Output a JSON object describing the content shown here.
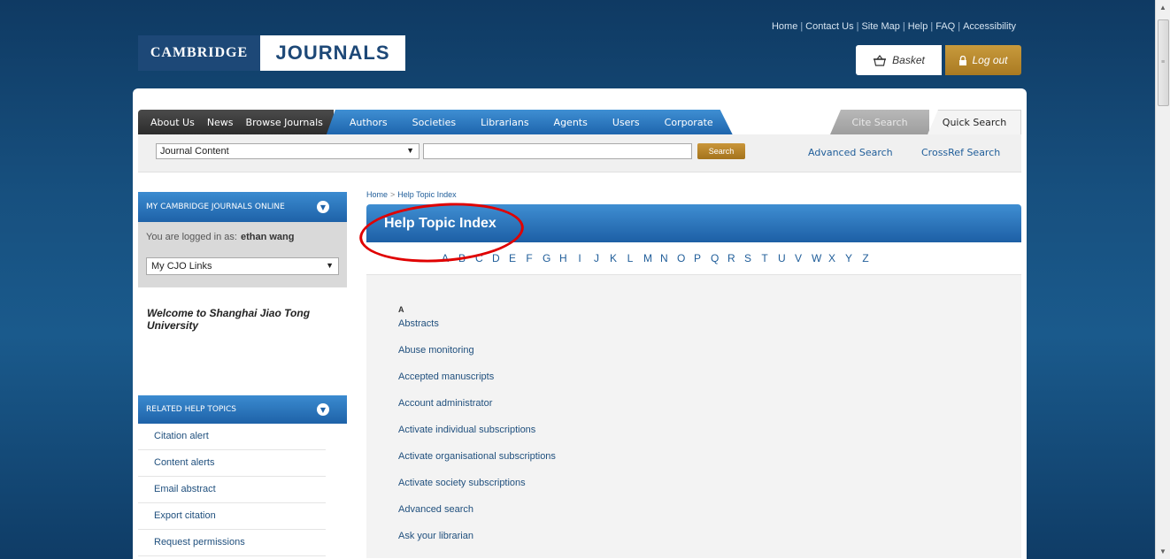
{
  "toplinks": [
    "Home",
    "Contact Us",
    "Site Map",
    "Help",
    "FAQ",
    "Accessibility"
  ],
  "logo": {
    "left": "CAMBRIDGE",
    "right": "JOURNALS"
  },
  "basket_label": "Basket",
  "logout_label": "Log out",
  "nav": {
    "dark": [
      "About Us",
      "News",
      "Browse Journals"
    ],
    "blue": [
      "Authors",
      "Societies",
      "Librarians",
      "Agents",
      "Users",
      "Corporate"
    ],
    "cite_search": "Cite Search",
    "quick_search": "Quick Search"
  },
  "search": {
    "scope_selected": "Journal Content",
    "query": "",
    "button": "Search",
    "advanced": "Advanced Search",
    "crossref": "CrossRef Search"
  },
  "sidebar": {
    "my_head": "MY CAMBRIDGE JOURNALS ONLINE",
    "logged_prefix": "You are logged in as:",
    "user": "ethan wang",
    "links_selected": "My CJO Links",
    "welcome": "Welcome to Shanghai Jiao Tong University",
    "related_head": "RELATED HELP TOPICS",
    "related": [
      "Citation alert",
      "Content alerts",
      "Email abstract",
      "Export citation",
      "Request permissions"
    ]
  },
  "content": {
    "breadcrumb": [
      "Home",
      "Help Topic Index"
    ],
    "breadcrumb_sep": ">",
    "title": "Help Topic Index",
    "letters": [
      "A",
      "B",
      "C",
      "D",
      "E",
      "F",
      "G",
      "H",
      "I",
      "J",
      "K",
      "L",
      "M",
      "N",
      "O",
      "P",
      "Q",
      "R",
      "S",
      "T",
      "U",
      "V",
      "W",
      "X",
      "Y",
      "Z"
    ],
    "current_letter": "A",
    "topics": [
      "Abstracts",
      "Abuse monitoring",
      "Accepted manuscripts",
      "Account administrator",
      "Activate individual subscriptions",
      "Activate organisational subscriptions",
      "Activate society subscriptions",
      "Advanced search",
      "Ask your librarian"
    ]
  },
  "colors": {
    "accent_blue": "#1f5d99",
    "annotation_red": "#e00000",
    "gold": "#b78528"
  }
}
